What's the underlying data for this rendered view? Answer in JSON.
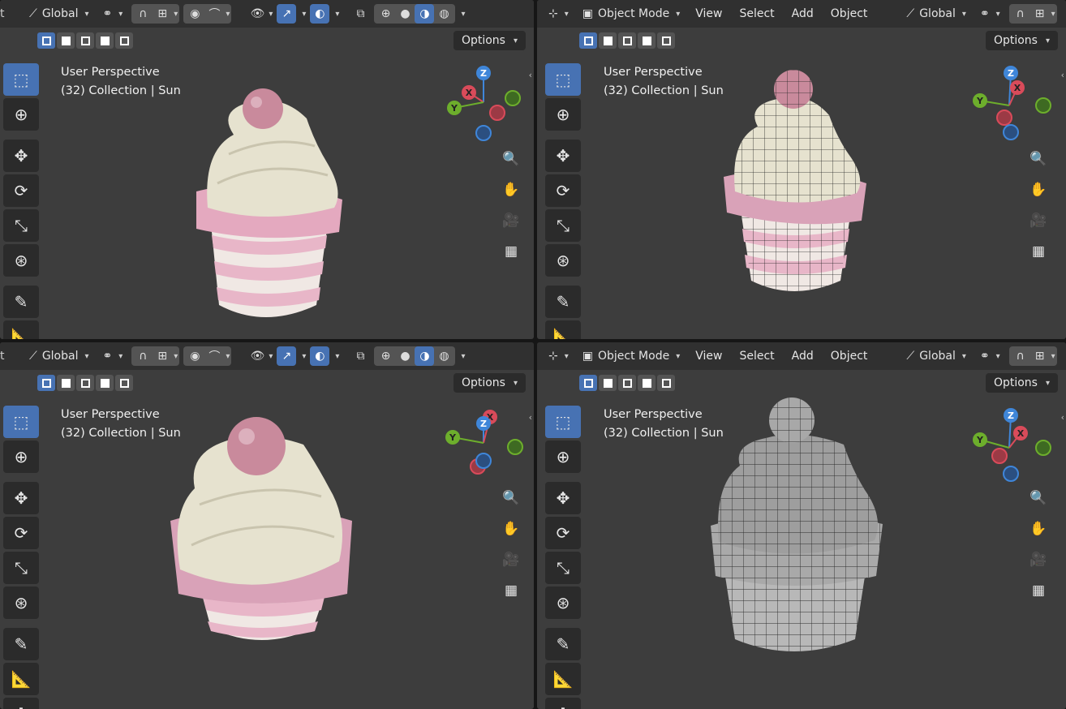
{
  "header_left": {
    "orientation_label": "Global"
  },
  "header_right": {
    "mode_label": "Object Mode",
    "menus": [
      "View",
      "Select",
      "Add",
      "Object"
    ],
    "orientation_label": "Global"
  },
  "options_label": "Options",
  "viewports": [
    {
      "id": "top-left",
      "title": "User Perspective",
      "collection": "(32) Collection | Sun",
      "shading": "material"
    },
    {
      "id": "top-right",
      "title": "User Perspective",
      "collection": "(32) Collection | Sun",
      "shading": "material-wireframe"
    },
    {
      "id": "bottom-left",
      "title": "User Perspective",
      "collection": "(32) Collection | Sun",
      "shading": "material"
    },
    {
      "id": "bottom-right",
      "title": "User Perspective",
      "collection": "(32) Collection | Sun",
      "shading": "solid-wireframe"
    }
  ],
  "gizmo_axes": {
    "x": "X",
    "y": "Y",
    "z": "Z"
  },
  "colors": {
    "viewport_bg": "#3d3d3d",
    "header_bg": "#303030",
    "active_blue": "#4772b3",
    "axis_x": "#d94b5a",
    "axis_y": "#6dae2c",
    "axis_z": "#3f86d9",
    "frosting": "#e6e2cf",
    "pink": "#e8b6c8",
    "cherry": "#c98a9c"
  },
  "icons": {
    "tools": [
      "select-box-icon",
      "cursor-icon",
      "move-icon",
      "rotate-icon",
      "scale-icon",
      "transform-icon",
      "annotate-icon",
      "measure-icon"
    ],
    "nav": [
      "zoom-icon",
      "hand-pan-icon",
      "camera-icon",
      "grid-perspective-icon"
    ]
  }
}
